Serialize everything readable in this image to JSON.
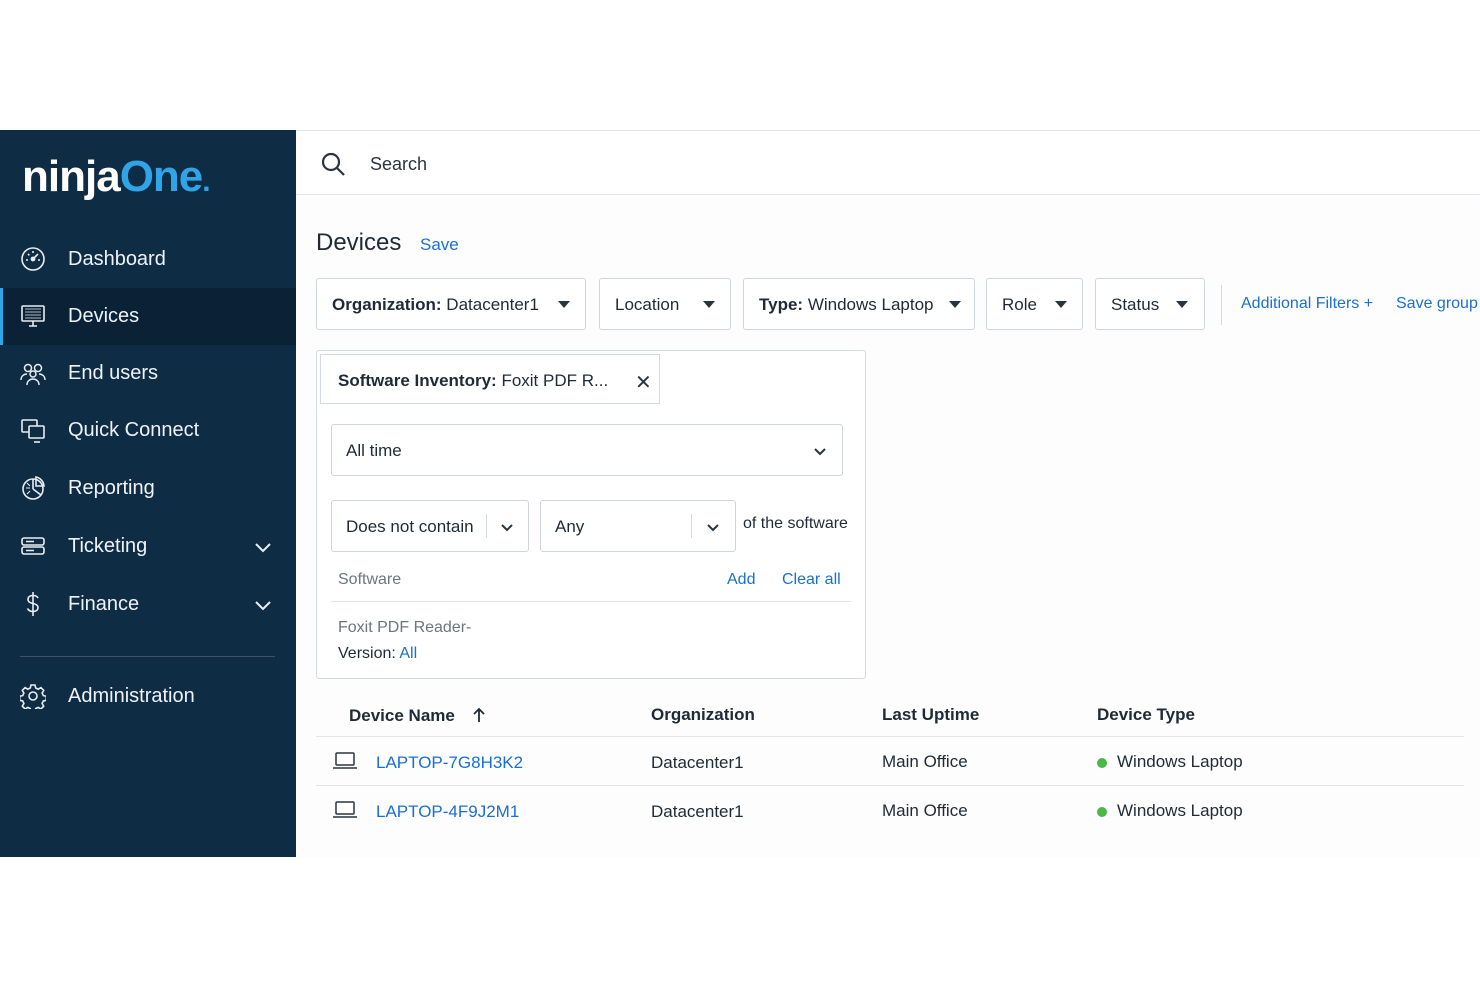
{
  "brand": {
    "part1": "ninja",
    "part2": "One",
    "dot": "."
  },
  "sidebar": {
    "items": [
      {
        "label": "Dashboard",
        "icon": "dashboard-icon"
      },
      {
        "label": "Devices",
        "icon": "monitor-icon",
        "active": true
      },
      {
        "label": "End users",
        "icon": "users-icon"
      },
      {
        "label": "Quick Connect",
        "icon": "quick-connect-icon"
      },
      {
        "label": "Reporting",
        "icon": "pie-chart-icon"
      },
      {
        "label": "Ticketing",
        "icon": "ticketing-icon",
        "expandable": true
      },
      {
        "label": "Finance",
        "icon": "dollar-icon",
        "expandable": true
      },
      {
        "label": "Administration",
        "icon": "gear-icon"
      }
    ]
  },
  "search": {
    "placeholder": "Search"
  },
  "page": {
    "title": "Devices",
    "save_label": "Save"
  },
  "filters": {
    "organization": {
      "key": "Organization:",
      "value": "Datacenter1"
    },
    "location": {
      "label": "Location"
    },
    "type": {
      "key": "Type:",
      "value": "Windows Laptop"
    },
    "role": {
      "label": "Role"
    },
    "status": {
      "label": "Status"
    },
    "additional_filters": "Additional Filters +",
    "save_group": "Save group"
  },
  "software_filter": {
    "chip_key": "Software Inventory:",
    "chip_value": "Foxit PDF R...",
    "time_range": "All time",
    "condition": "Does not contain",
    "quantifier": "Any",
    "suffix_text": "of the software",
    "list_label": "Software",
    "add_label": "Add",
    "clear_label": "Clear all",
    "entry_name": "Foxit PDF Reader-",
    "entry_version_label": "Version:",
    "entry_version_value": "All"
  },
  "table": {
    "columns": [
      "Device Name",
      "Organization",
      "Last Uptime",
      "Device Type"
    ],
    "rows": [
      {
        "device_name": "LAPTOP-7G8H3K2",
        "organization": "Datacenter1",
        "last_uptime": "Main Office",
        "device_type": "Windows Laptop",
        "status_color": "#4cb648"
      },
      {
        "device_name": "LAPTOP-4F9J2M1",
        "organization": "Datacenter1",
        "last_uptime": "Main Office",
        "device_type": "Windows Laptop",
        "status_color": "#4cb648"
      }
    ]
  },
  "colors": {
    "sidebar_bg": "#0f2c45",
    "accent": "#2fa4e7",
    "link": "#1a6fd1",
    "online": "#4cb648"
  }
}
